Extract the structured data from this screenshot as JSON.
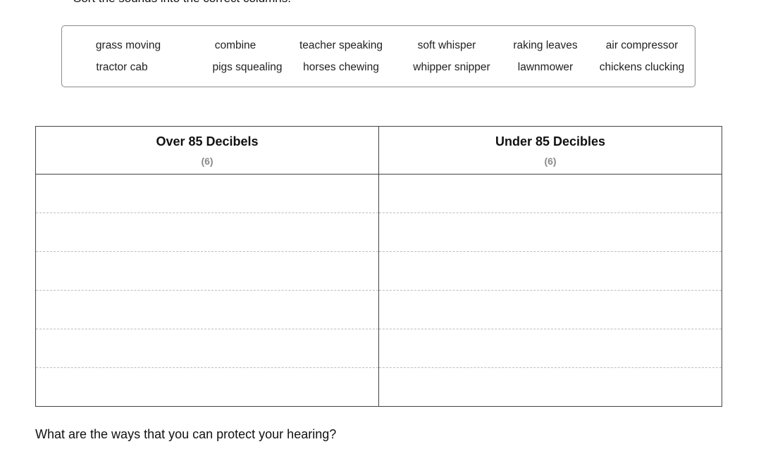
{
  "instruction": "Sort the sounds into the correct columns.",
  "word_bank": {
    "row1": [
      "grass moving",
      "combine",
      "teacher speaking",
      "soft whisper",
      "raking leaves",
      "air compressor"
    ],
    "row2": [
      "tractor cab",
      "pigs squealing",
      "horses chewing",
      "whipper snipper",
      "lawnmower",
      "chickens clucking"
    ]
  },
  "table": {
    "columns": [
      {
        "title": "Over 85 Decibels",
        "count": "(6)"
      },
      {
        "title": "Under 85 Decibles",
        "count": "(6)"
      }
    ],
    "answer_rows": 6
  },
  "question": "What are the ways that you can protect your hearing?"
}
